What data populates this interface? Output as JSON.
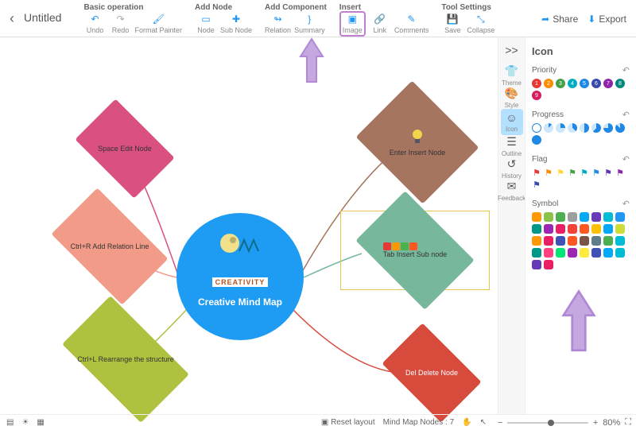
{
  "header": {
    "title": "Untitled",
    "groups": [
      {
        "title": "Basic operation",
        "tools": [
          {
            "name": "undo-icon",
            "label": "Undo",
            "glyph": "↶"
          },
          {
            "name": "redo-icon",
            "label": "Redo",
            "glyph": "↷",
            "grey": true
          },
          {
            "name": "format-painter-icon",
            "label": "Format Painter",
            "glyph": "🖌"
          }
        ]
      },
      {
        "title": "Add Node",
        "tools": [
          {
            "name": "node-icon",
            "label": "Node",
            "glyph": "▭"
          },
          {
            "name": "sub-node-icon",
            "label": "Sub Node",
            "glyph": "✚"
          }
        ]
      },
      {
        "title": "Add Component",
        "tools": [
          {
            "name": "relation-icon",
            "label": "Relation",
            "glyph": "↬"
          },
          {
            "name": "summary-icon",
            "label": "Summary",
            "glyph": "}"
          }
        ]
      },
      {
        "title": "Insert",
        "tools": [
          {
            "name": "image-icon",
            "label": "Image",
            "glyph": "▣",
            "highlight": true
          },
          {
            "name": "link-icon",
            "label": "Link",
            "glyph": "🔗"
          },
          {
            "name": "comments-icon",
            "label": "Comments",
            "glyph": "✎"
          }
        ]
      },
      {
        "title": "Tool Settings",
        "tools": [
          {
            "name": "save-icon",
            "label": "Save",
            "glyph": "💾",
            "grey": true
          },
          {
            "name": "collapse-icon",
            "label": "Collapse",
            "glyph": "⤡"
          }
        ]
      }
    ],
    "share": "Share",
    "export": "Export"
  },
  "mindmap": {
    "center": {
      "badge": "CREATIVITY",
      "title": "Creative Mind Map"
    },
    "nodes": {
      "n1": {
        "label": "Space Edit Node"
      },
      "n2": {
        "label": "Ctrl+R Add Relation Line"
      },
      "n3": {
        "label": "Ctrl+L Rearrange the structure"
      },
      "n4": {
        "label": "Enter Insert Node"
      },
      "n5": {
        "label": "Tab Insert Sub node"
      },
      "n6": {
        "label": "Del Delete Node"
      }
    }
  },
  "rail": {
    "collapse": ">>",
    "items": [
      {
        "name": "theme",
        "label": "Theme",
        "glyph": "👕"
      },
      {
        "name": "style",
        "label": "Style",
        "glyph": "🎨"
      },
      {
        "name": "icon",
        "label": "Icon",
        "glyph": "☺",
        "active": true
      },
      {
        "name": "outline",
        "label": "Outline",
        "glyph": "☰"
      },
      {
        "name": "history",
        "label": "History",
        "glyph": "↺"
      },
      {
        "name": "feedback",
        "label": "Feedback",
        "glyph": "✉"
      }
    ]
  },
  "panel": {
    "title": "Icon",
    "sections": {
      "priority": {
        "title": "Priority",
        "items": [
          {
            "t": "1",
            "c": "#e53935"
          },
          {
            "t": "2",
            "c": "#fb8c00"
          },
          {
            "t": "3",
            "c": "#43a047"
          },
          {
            "t": "4",
            "c": "#00acc1"
          },
          {
            "t": "5",
            "c": "#1e88e5"
          },
          {
            "t": "6",
            "c": "#3949ab"
          },
          {
            "t": "7",
            "c": "#8e24aa"
          },
          {
            "t": "8",
            "c": "#00897b"
          },
          {
            "t": "9",
            "c": "#d81b60"
          }
        ]
      },
      "progress": {
        "title": "Progress",
        "items": [
          {
            "c": "#fff",
            "b": "#1e88e5"
          },
          {
            "c": "#1e88e5",
            "p": 12
          },
          {
            "c": "#1e88e5",
            "p": 25
          },
          {
            "c": "#1e88e5",
            "p": 37
          },
          {
            "c": "#1e88e5",
            "p": 50
          },
          {
            "c": "#1e88e5",
            "p": 62
          },
          {
            "c": "#1e88e5",
            "p": 75
          },
          {
            "c": "#1e88e5",
            "p": 87
          },
          {
            "c": "#1e88e5",
            "p": 100
          }
        ]
      },
      "flag": {
        "title": "Flag",
        "colors": [
          "#e53935",
          "#fb8c00",
          "#fdd835",
          "#43a047",
          "#00acc1",
          "#1e88e5",
          "#5e35b1",
          "#8e24aa",
          "#3949ab"
        ]
      },
      "symbol": {
        "title": "Symbol",
        "items": [
          "#ff9800",
          "#8bc34a",
          "#4caf50",
          "#9e9e9e",
          "#03a9f4",
          "#673ab7",
          "#00bcd4",
          "#2196f3",
          "#009688",
          "#9c27b0",
          "#e91e63",
          "#f44336",
          "#ff5722",
          "#ffc107",
          "#03a9f4",
          "#cddc39",
          "#ff9800",
          "#e91e63",
          "#3f51b5",
          "#ff5722",
          "#795548",
          "#607d8b",
          "#4caf50",
          "#00bcd4",
          "#009688",
          "#ff4081",
          "#00e676",
          "#9c27b0",
          "#ffeb3b",
          "#3f51b5",
          "#03a9f4",
          "#00bcd4",
          "#673ab7",
          "#e91e63"
        ]
      }
    }
  },
  "bottom": {
    "reset": "Reset layout",
    "nodes_label": "Mind Map Nodes :",
    "nodes_count": "7",
    "zoom": "80%"
  }
}
